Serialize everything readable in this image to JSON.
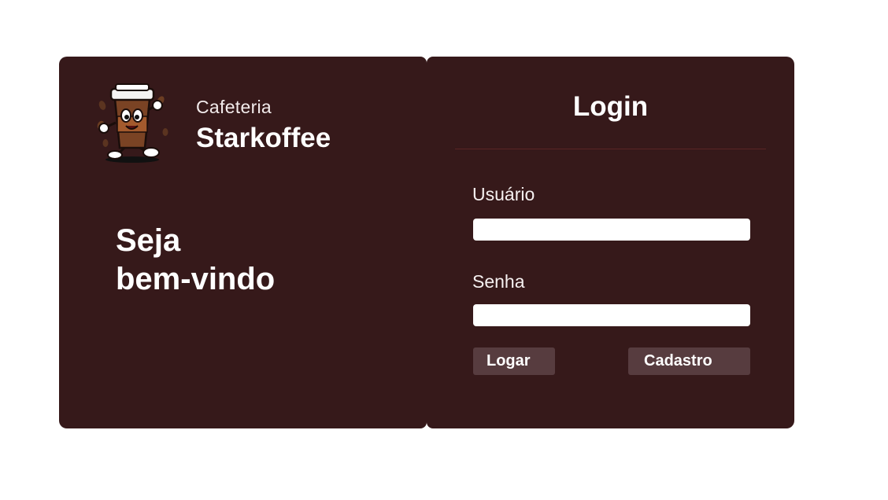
{
  "brand": {
    "subtitle": "Cafeteria",
    "name": "Starkoffee",
    "logo_icon": "coffee-cup-mascot-icon"
  },
  "welcome": {
    "line1": "Seja",
    "line2": "bem-vindo"
  },
  "login": {
    "title": "Login",
    "username_label": "Usuário",
    "username_value": "",
    "password_label": "Senha",
    "password_value": "",
    "login_button": "Logar",
    "register_button": "Cadastro"
  },
  "colors": {
    "panel_background": "#36191a",
    "button_background": "#573c3f",
    "divider": "#5a2424",
    "page_background": "#ffffff"
  }
}
